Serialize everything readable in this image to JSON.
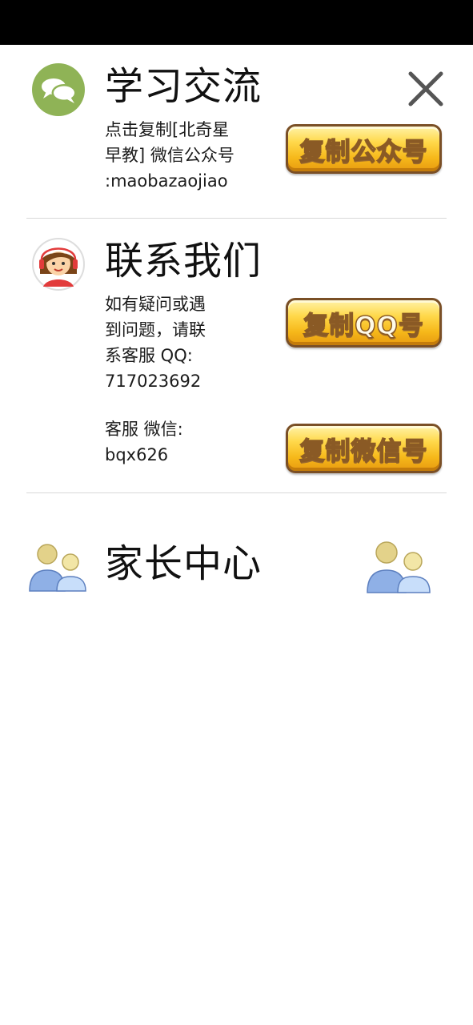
{
  "study_section": {
    "title": "学习交流",
    "description": "点击复制[北奇星\n早教] 微信公众号\n:maobazaojiao",
    "button_label": "复制公众号"
  },
  "contact_section": {
    "title": "联系我们",
    "qq_text": "如有疑问或遇\n到问题，请联\n系客服 QQ:\n717023692",
    "qq_button_label": "复制QQ号",
    "wechat_text": "客服 微信:\nbqx626",
    "wechat_button_label": "复制微信号"
  },
  "parent_section": {
    "title": "家长中心"
  },
  "icons": {
    "close": "close-icon",
    "chat": "chat-bubbles-icon",
    "support": "customer-service-icon",
    "parents": "parents-icon"
  },
  "colors": {
    "button_gold": "#f6b81a",
    "button_border": "#7a4f26",
    "chat_icon_green": "#8fb356",
    "parent_blue": "#8fb0e6",
    "parent_head": "#e3d28a"
  }
}
